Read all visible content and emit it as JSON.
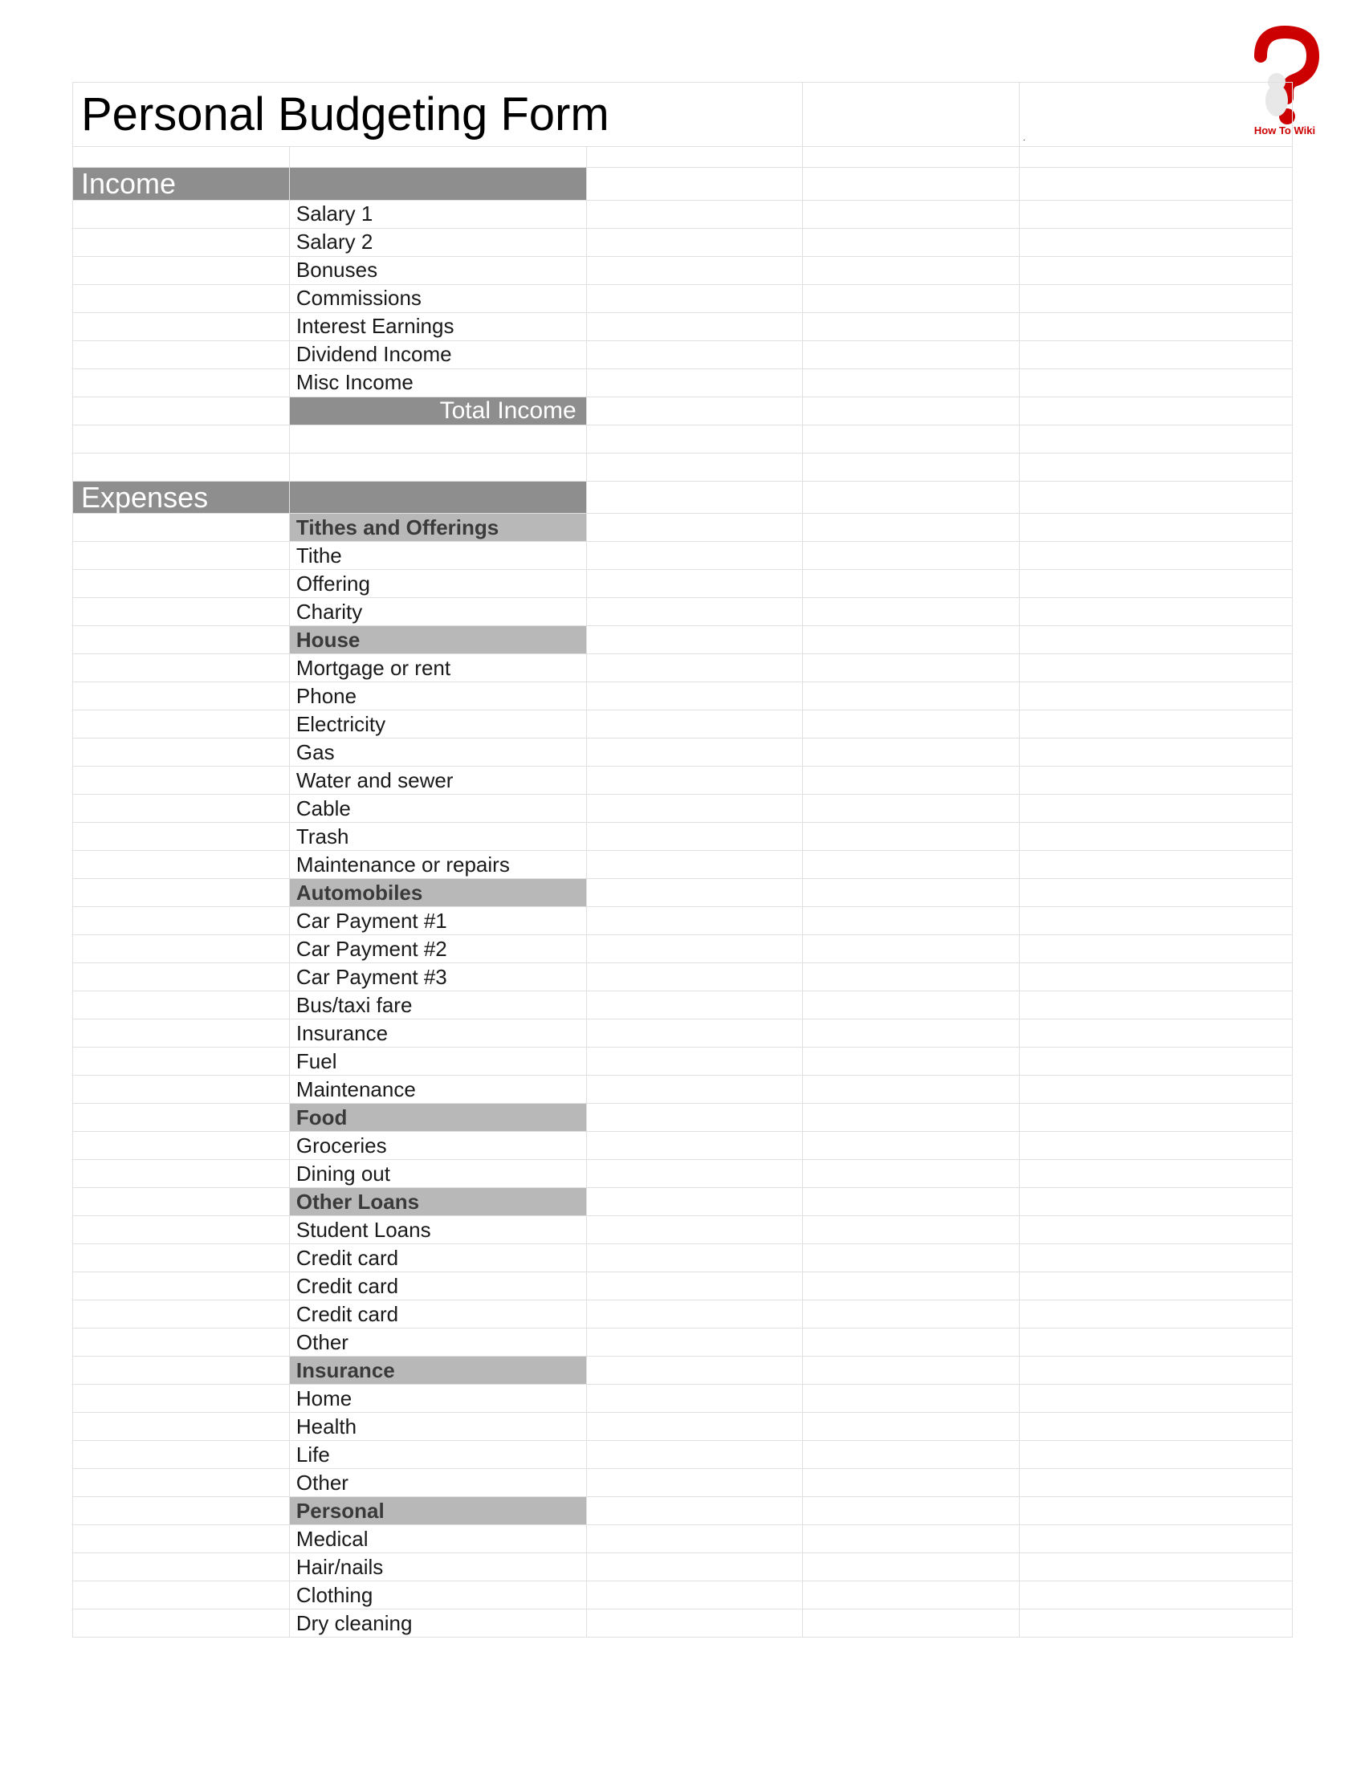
{
  "logo": {
    "label": "How To Wiki"
  },
  "title": "Personal Budgeting Form",
  "sections": {
    "income": {
      "header": "Income",
      "items": [
        "Salary 1",
        "Salary 2",
        "Bonuses",
        "Commissions",
        "Interest Earnings",
        "Dividend Income",
        "Misc Income"
      ],
      "total_label": "Total Income"
    },
    "expenses": {
      "header": "Expenses",
      "groups": [
        {
          "name": "Tithes and Offerings",
          "items": [
            "Tithe",
            "Offering",
            "Charity"
          ]
        },
        {
          "name": "House",
          "items": [
            "Mortgage or rent",
            "Phone",
            "Electricity",
            "Gas",
            "Water and sewer",
            "Cable",
            "Trash",
            "Maintenance or repairs"
          ]
        },
        {
          "name": "Automobiles",
          "items": [
            "Car Payment #1",
            "Car Payment #2",
            "Car Payment #3",
            "Bus/taxi fare",
            "Insurance",
            "Fuel",
            "Maintenance"
          ]
        },
        {
          "name": "Food",
          "items": [
            "Groceries",
            "Dining out"
          ]
        },
        {
          "name": "Other Loans",
          "items": [
            "Student Loans",
            "Credit card",
            "Credit card",
            "Credit card",
            "Other"
          ]
        },
        {
          "name": "Insurance",
          "items": [
            "Home",
            "Health",
            "Life",
            "Other"
          ]
        },
        {
          "name": "Personal",
          "items": [
            "Medical",
            "Hair/nails",
            "Clothing",
            "Dry cleaning"
          ]
        }
      ]
    }
  }
}
